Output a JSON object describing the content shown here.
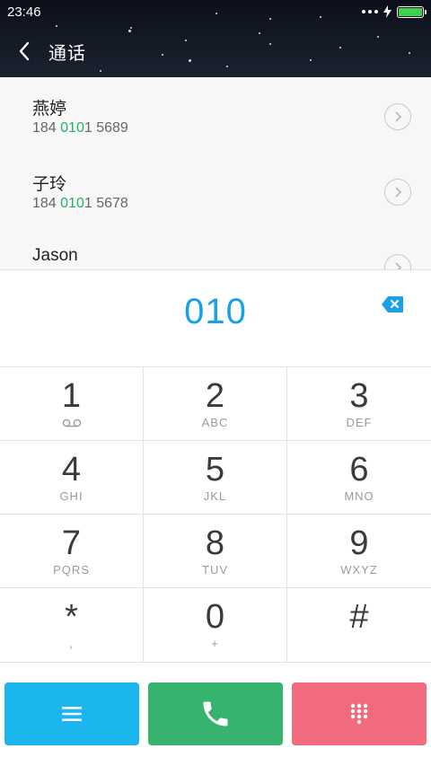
{
  "status": {
    "time": "23:46"
  },
  "header": {
    "title": "通话"
  },
  "results": [
    {
      "name": "燕婷",
      "num_pre": "184 ",
      "num_hl": "010",
      "num_post": "1 5689"
    },
    {
      "name": "子玲",
      "num_pre": "184 ",
      "num_hl": "010",
      "num_post": "1 5678"
    },
    {
      "name": "Jason",
      "num_pre": "",
      "num_hl": "",
      "num_post": ""
    }
  ],
  "entry": {
    "number": "010"
  },
  "keys": [
    {
      "digit": "1",
      "letters": "",
      "sub": "voicemail-icon"
    },
    {
      "digit": "2",
      "letters": "ABC",
      "sub": ""
    },
    {
      "digit": "3",
      "letters": "DEF",
      "sub": ""
    },
    {
      "digit": "4",
      "letters": "GHI",
      "sub": ""
    },
    {
      "digit": "5",
      "letters": "JKL",
      "sub": ""
    },
    {
      "digit": "6",
      "letters": "MNO",
      "sub": ""
    },
    {
      "digit": "7",
      "letters": "PQRS",
      "sub": ""
    },
    {
      "digit": "8",
      "letters": "TUV",
      "sub": ""
    },
    {
      "digit": "9",
      "letters": "WXYZ",
      "sub": ""
    },
    {
      "digit": "*",
      "letters": ",",
      "sub": ""
    },
    {
      "digit": "0",
      "letters": "+",
      "sub": ""
    },
    {
      "digit": "#",
      "letters": "",
      "sub": ""
    }
  ],
  "colors": {
    "accent_blue": "#1aa0e6",
    "highlight_green": "#22b26a",
    "menu_button": "#1cb6ef",
    "call_button": "#35b36f",
    "keypad_button": "#f26a7d"
  },
  "icons": {
    "back": "chevron-left-icon",
    "result_action": "chevron-right-circle-icon",
    "backspace": "backspace-icon",
    "menu": "menu-icon",
    "call": "phone-icon",
    "keypad": "dialpad-icon"
  }
}
